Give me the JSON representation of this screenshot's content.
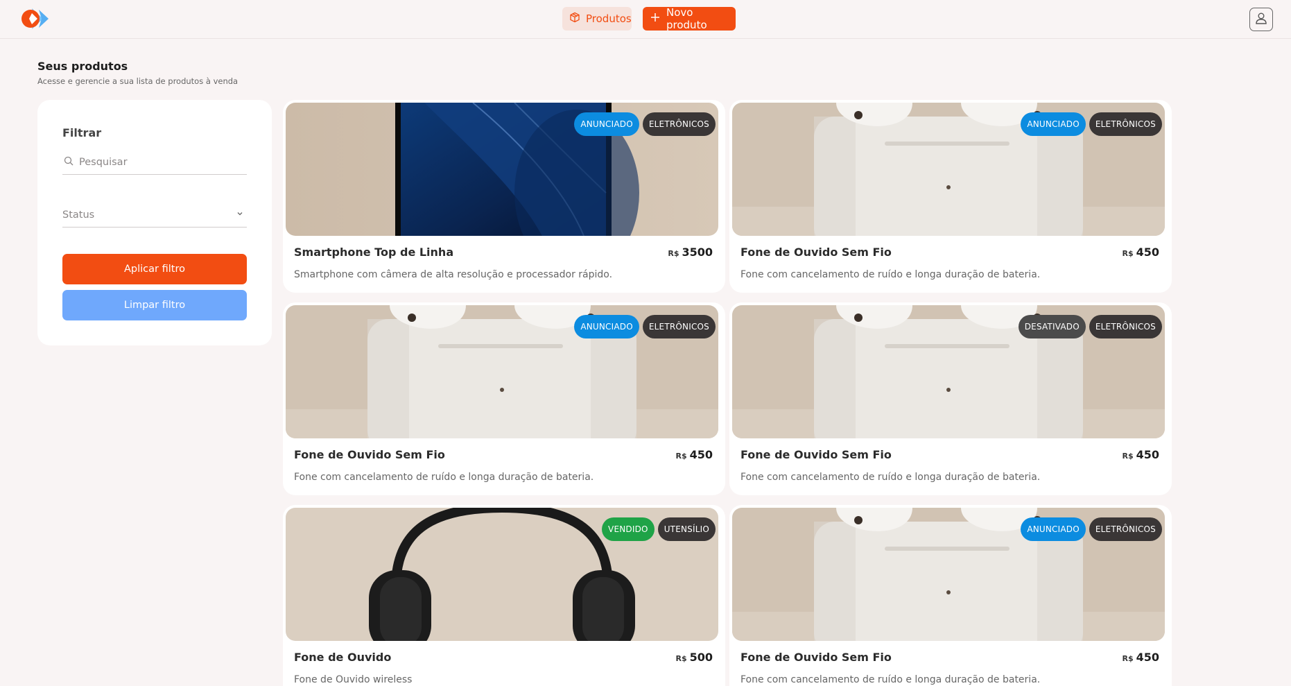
{
  "header": {
    "nav_products_label": "Produtos",
    "nav_new_label": "Novo produto"
  },
  "page": {
    "title": "Seus produtos",
    "subtitle": "Acesse e gerencie a sua lista de produtos à venda"
  },
  "filter": {
    "title": "Filtrar",
    "search_placeholder": "Pesquisar",
    "status_placeholder": "Status",
    "apply_label": "Aplicar filtro",
    "clear_label": "Limpar filtro"
  },
  "products": [
    {
      "title": "Smartphone Top de Linha",
      "currency": "R$",
      "price": "3500",
      "description": "Smartphone com câmera de alta resolução e processador rápido.",
      "status": "ANUNCIADO",
      "category": "ELETRÔNICOS",
      "image": "smartphone"
    },
    {
      "title": "Fone de Ouvido Sem Fio",
      "currency": "R$",
      "price": "450",
      "description": "Fone com cancelamento de ruído e longa duração de bateria.",
      "status": "ANUNCIADO",
      "category": "ELETRÔNICOS",
      "image": "earbuds-case"
    },
    {
      "title": "Fone de Ouvido Sem Fio",
      "currency": "R$",
      "price": "450",
      "description": "Fone com cancelamento de ruído e longa duração de bateria.",
      "status": "ANUNCIADO",
      "category": "ELETRÔNICOS",
      "image": "earbuds-case"
    },
    {
      "title": "Fone de Ouvido Sem Fio",
      "currency": "R$",
      "price": "450",
      "description": "Fone com cancelamento de ruído e longa duração de bateria.",
      "status": "DESATIVADO",
      "category": "ELETRÔNICOS",
      "image": "earbuds-case"
    },
    {
      "title": "Fone de Ouvido",
      "currency": "R$",
      "price": "500",
      "description": "Fone de Ouvido wireless",
      "status": "VENDIDO",
      "category": "UTENSÍLIO",
      "image": "headphones"
    },
    {
      "title": "Fone de Ouvido Sem Fio",
      "currency": "R$",
      "price": "450",
      "description": "Fone com cancelamento de ruído e longa duração de bateria.",
      "status": "ANUNCIADO",
      "category": "ELETRÔNICOS",
      "image": "earbuds-case"
    }
  ],
  "colors": {
    "brand": "#f24d12",
    "secondary_button": "#6fa8fc",
    "status_anunciado": "#0c8ce0",
    "status_desativado": "#4b4b4b",
    "status_vendido": "#1fa347"
  }
}
